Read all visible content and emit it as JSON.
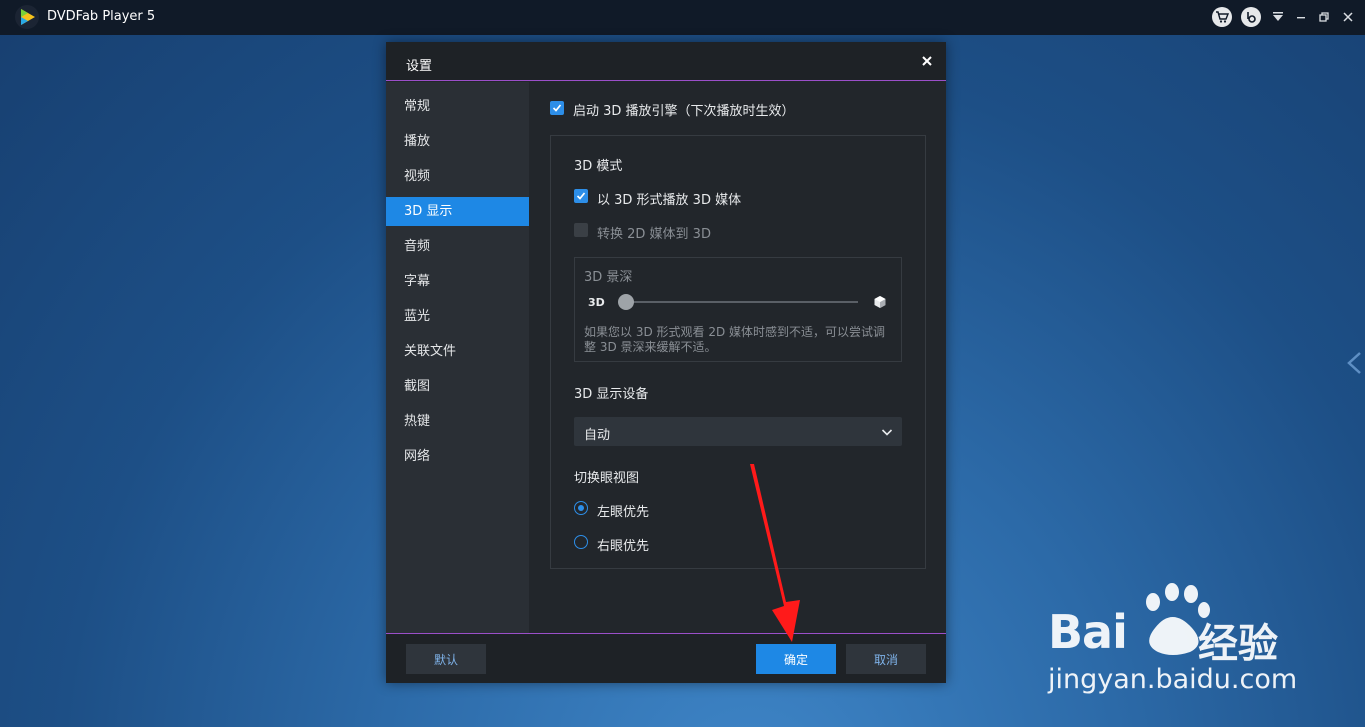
{
  "app": {
    "title": "DVDFab Player 5"
  },
  "dialog": {
    "title": "设置",
    "nav": [
      {
        "label": "常规"
      },
      {
        "label": "播放"
      },
      {
        "label": "视频"
      },
      {
        "label": "3D 显示",
        "active": true
      },
      {
        "label": "音频"
      },
      {
        "label": "字幕"
      },
      {
        "label": "蓝光"
      },
      {
        "label": "关联文件"
      },
      {
        "label": "截图"
      },
      {
        "label": "热键"
      },
      {
        "label": "网络"
      }
    ],
    "enable_3d_label": "启动 3D 播放引擎（下次播放时生效）",
    "enable_3d_checked": true,
    "mode_heading": "3D 模式",
    "play_3d_label": "以 3D 形式播放 3D 媒体",
    "play_3d_checked": true,
    "convert_label": "转换 2D 媒体到 3D",
    "convert_checked": false,
    "depth": {
      "heading": "3D 景深",
      "left_label": "3D",
      "value": 0,
      "hint": "如果您以 3D 形式观看 2D 媒体时感到不适，可以尝试调整 3D 景深来缓解不适。"
    },
    "device": {
      "heading": "3D 显示设备",
      "selected": "自动"
    },
    "eye": {
      "heading": "切换眼视图",
      "options": [
        {
          "label": "左眼优先",
          "selected": true
        },
        {
          "label": "右眼优先",
          "selected": false
        }
      ]
    },
    "buttons": {
      "default": "默认",
      "ok": "确定",
      "cancel": "取消"
    }
  },
  "watermark": {
    "logo": "Bai",
    "logo_cn": "经验",
    "url": "jingyan.baidu.com"
  },
  "colors": {
    "accent": "#1e88e5",
    "annotation": "#ff1a1a"
  }
}
